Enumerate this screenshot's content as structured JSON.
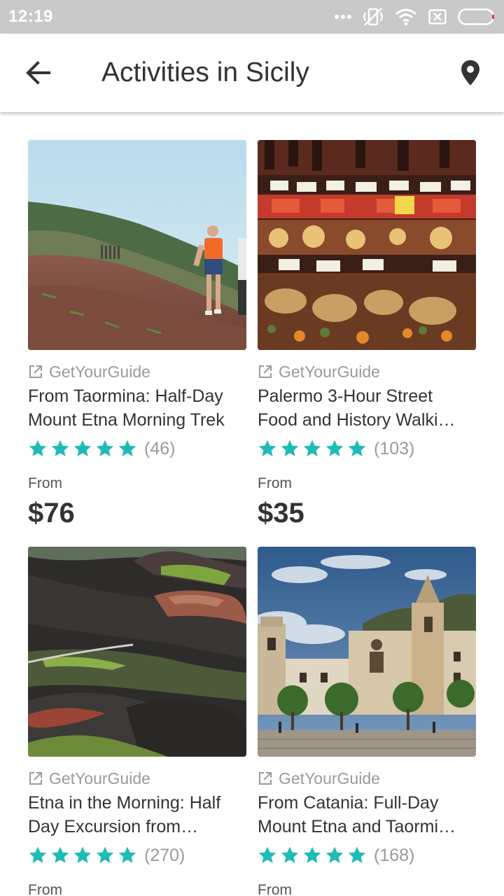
{
  "status_bar": {
    "time": "12:19",
    "icons": [
      "more-dots-icon",
      "vibrate-icon",
      "wifi-icon",
      "sim-icon",
      "battery-icon"
    ]
  },
  "app_bar": {
    "title": "Activities in Sicily",
    "back_icon": "arrow-back-icon",
    "map_icon": "location-pin-icon"
  },
  "colors": {
    "star": "#1fbcb7",
    "status_bar": "#c9c9c9",
    "secondary_text": "#9a9a9a"
  },
  "activities": [
    {
      "image": "etna-hikers-photo",
      "provider": "GetYourGuide",
      "title": "From Taormina: Half-Day Mount Etna Morning Trek",
      "stars": 5,
      "reviews": "(46)",
      "from_label": "From",
      "price": "$76"
    },
    {
      "image": "palermo-market-photo",
      "provider": "GetYourGuide",
      "title": "Palermo 3-Hour Street Food and History Walki…",
      "stars": 5,
      "reviews": "(103)",
      "from_label": "From",
      "price": "$35"
    },
    {
      "image": "etna-craters-photo",
      "provider": "GetYourGuide",
      "title": "Etna in the Morning: Half Day Excursion from…",
      "stars": 5,
      "reviews": "(270)",
      "from_label": "From",
      "price": ""
    },
    {
      "image": "taormina-square-photo",
      "provider": "GetYourGuide",
      "title": "From Catania: Full-Day Mount Etna and Taormi…",
      "stars": 5,
      "reviews": "(168)",
      "from_label": "From",
      "price": ""
    }
  ]
}
